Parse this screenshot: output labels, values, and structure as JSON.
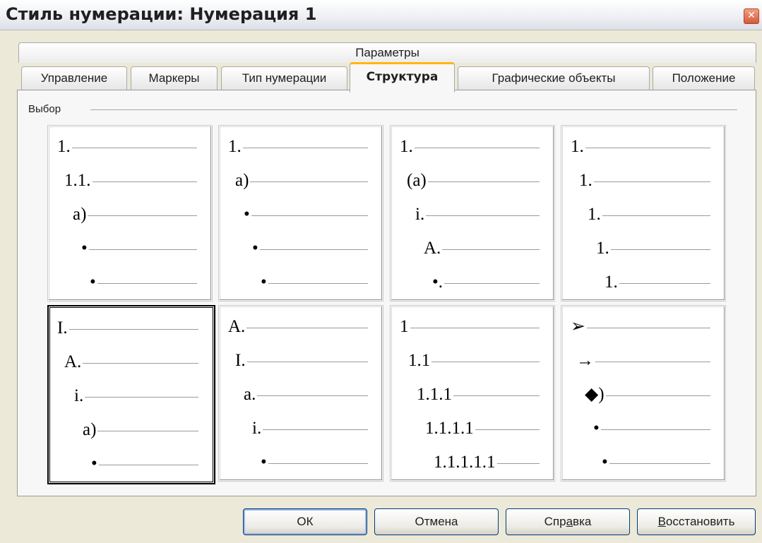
{
  "window": {
    "title": "Стиль нумерации: Нумерация 1",
    "close_icon": "close-icon"
  },
  "tabs": {
    "row1": [
      "Параметры"
    ],
    "row2": [
      "Управление",
      "Маркеры",
      "Тип нумерации",
      "Структура",
      "Графические объекты",
      "Положение"
    ],
    "active": "Структура"
  },
  "group_label": "Выбор",
  "presets": [
    {
      "levels": [
        "1.",
        "1.1.",
        "a)",
        "•",
        "•"
      ],
      "selected": false
    },
    {
      "levels": [
        "1.",
        "a)",
        "•",
        "•",
        "•"
      ],
      "selected": false
    },
    {
      "levels": [
        "1.",
        "(a)",
        "i.",
        "A.",
        "•."
      ],
      "selected": false
    },
    {
      "levels": [
        "1.",
        "1.",
        "1.",
        "1.",
        "1."
      ],
      "selected": false
    },
    {
      "levels": [
        "I.",
        "A.",
        "i.",
        "a)",
        "•"
      ],
      "selected": true
    },
    {
      "levels": [
        "A.",
        "I.",
        "a.",
        "i.",
        "•"
      ],
      "selected": false
    },
    {
      "levels": [
        "1",
        "1.1",
        "1.1.1",
        "1.1.1.1",
        "1.1.1.1.1"
      ],
      "selected": false
    },
    {
      "levels": [
        "➢",
        "→",
        "◆)",
        "•",
        "•"
      ],
      "selected": false
    }
  ],
  "buttons": {
    "ok": "ОК",
    "cancel": "Отмена",
    "help": {
      "before": "Спр",
      "mnemonic": "а",
      "after": "вка"
    },
    "reset": {
      "before": "",
      "mnemonic": "В",
      "after": "осстановить"
    }
  }
}
